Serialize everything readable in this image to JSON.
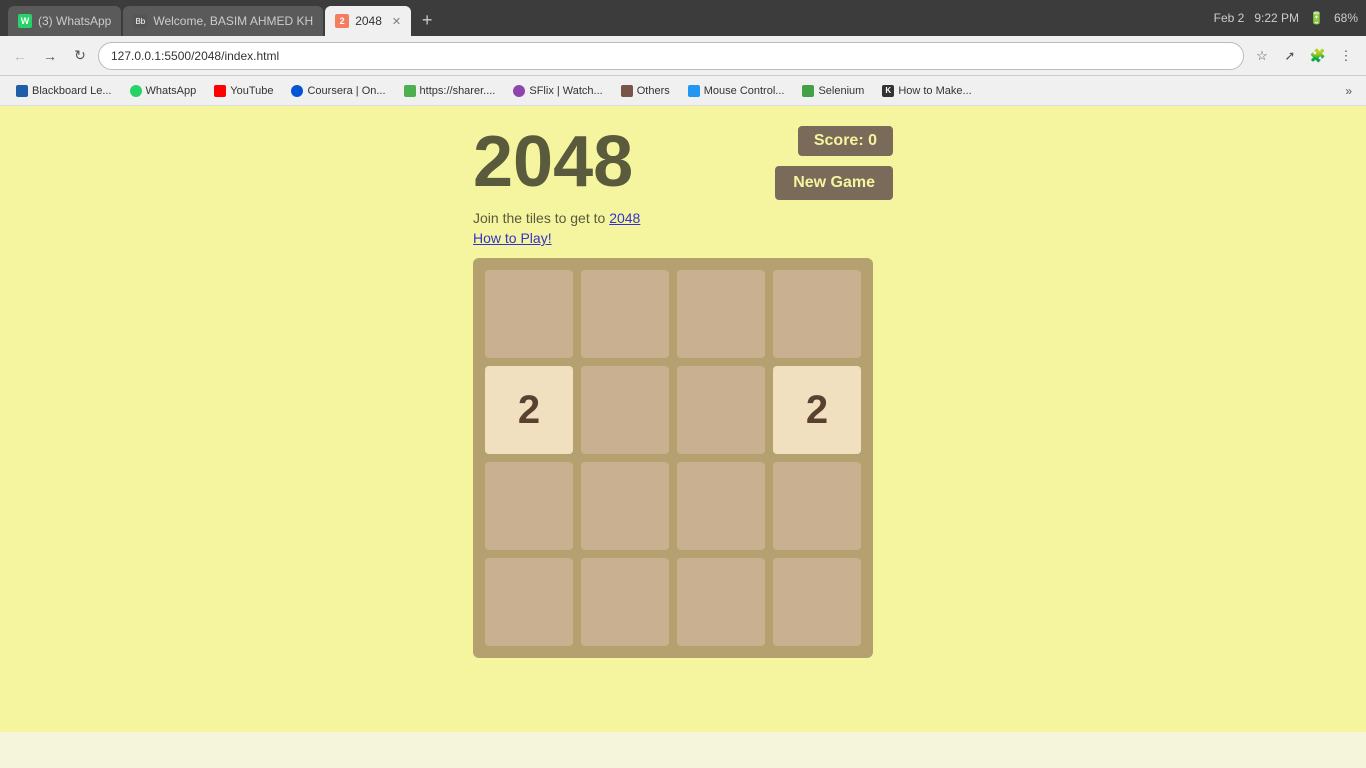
{
  "browser": {
    "tabs": [
      {
        "id": "tab-whatsapp",
        "label": "(3) WhatsApp",
        "favicon_color": "#25D366",
        "favicon_text": "W",
        "active": false
      },
      {
        "id": "tab-welcome",
        "label": "Welcome, BASIM AHMED KH",
        "favicon_color": "#666",
        "favicon_text": "Bb",
        "active": false
      },
      {
        "id": "tab-2048",
        "label": "2048",
        "favicon_color": "#f67c5f",
        "favicon_text": "2",
        "active": true
      }
    ],
    "new_tab_label": "+",
    "url": "127.0.0.1:5500/2048/index.html",
    "system_time": "9:22 PM",
    "system_date": "Feb 2",
    "battery": "68%"
  },
  "bookmarks": [
    {
      "id": "bm-blackboard",
      "label": "Blackboard Le...",
      "color": "#1e5fa8"
    },
    {
      "id": "bm-whatsapp",
      "label": "WhatsApp",
      "color": "#25D366"
    },
    {
      "id": "bm-youtube",
      "label": "YouTube",
      "color": "#ff0000"
    },
    {
      "id": "bm-coursera",
      "label": "Coursera | On...",
      "color": "#0056d2"
    },
    {
      "id": "bm-sharer",
      "label": "https://sharer....",
      "color": "#4caf50"
    },
    {
      "id": "bm-sflix",
      "label": "SFlix | Watch...",
      "color": "#8e44ad"
    },
    {
      "id": "bm-others",
      "label": "Others",
      "color": "#795548"
    },
    {
      "id": "bm-mouse",
      "label": "Mouse Control...",
      "color": "#2196f3"
    },
    {
      "id": "bm-selenium",
      "label": "Selenium",
      "color": "#43a047"
    },
    {
      "id": "bm-howto",
      "label": "How to Make...",
      "color": "#333"
    }
  ],
  "game": {
    "title": "2048",
    "score_label": "Score: 0",
    "join_text": "Join the tiles to get to",
    "target": "2048",
    "how_to_play": "How to Play!",
    "new_game_btn": "New Game",
    "board": [
      [
        0,
        0,
        0,
        0
      ],
      [
        2,
        0,
        0,
        2
      ],
      [
        0,
        0,
        0,
        0
      ],
      [
        0,
        0,
        0,
        0
      ]
    ]
  }
}
